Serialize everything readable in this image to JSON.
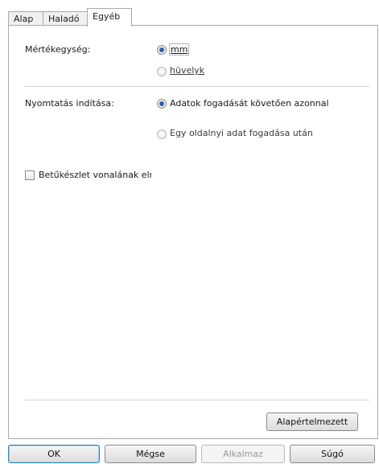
{
  "tabs": [
    {
      "label": "Alap",
      "active": false
    },
    {
      "label": "Haladó",
      "active": false
    },
    {
      "label": "Egyéb",
      "active": true
    }
  ],
  "units": {
    "label": "Mértékegység:",
    "options": [
      {
        "label": "mm",
        "checked": true
      },
      {
        "label": "hüvelyk",
        "checked": false
      }
    ]
  },
  "print_start": {
    "label": "Nyomtatás indítása:",
    "options": [
      {
        "label": "Adatok fogadását követően azonnal",
        "checked": true
      },
      {
        "label": "Egy oldalnyi adat fogadása után",
        "checked": false
      }
    ]
  },
  "font_outline_checkbox": {
    "label": "Betűkészlet vonalának elre",
    "checked": false
  },
  "defaults_button": {
    "label": "Alapértelmezett"
  },
  "footer": {
    "ok": "OK",
    "cancel": "Mégse",
    "apply": "Alkalmaz",
    "help": "Súgó"
  }
}
